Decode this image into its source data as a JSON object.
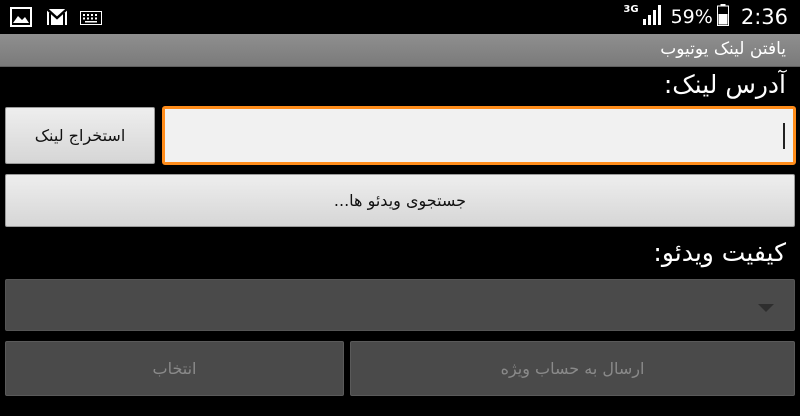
{
  "status_bar": {
    "left_icons": [
      "image-icon",
      "gmail-icon",
      "keyboard-icon"
    ],
    "network_type": "3G",
    "battery_percent": "59%",
    "time": "2:36"
  },
  "app": {
    "title": "یافتن لینک یوتیوب"
  },
  "form": {
    "link_label": "آدرس لینک:",
    "link_value": "",
    "extract_button": "استخراج لینک",
    "search_button": "جستجوی ویدئو ها...",
    "quality_label": "کیفیت ویدئو:",
    "quality_selected": "",
    "select_button": "انتخاب",
    "send_vip_button": "ارسال به حساب ویژه"
  },
  "colors": {
    "input_focus_border": "#ff8c1a",
    "title_bar": "#858585",
    "background": "#000000"
  }
}
